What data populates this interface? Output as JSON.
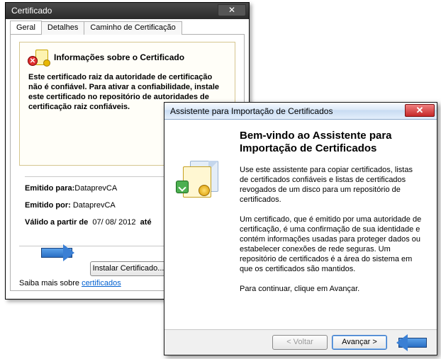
{
  "cert": {
    "window_title": "Certificado",
    "close_glyph": "✕",
    "tabs": {
      "general": "Geral",
      "details": "Detalhes",
      "path": "Caminho de Certificação"
    },
    "info_title": "Informações sobre o Certificado",
    "info_text": "Este certificado raiz da autoridade de certificação não é confiável. Para ativar a confiabilidade, instale este certificado no repositório de autoridades de certificação raiz confiáveis.",
    "issued_to_label": "Emitido para:",
    "issued_to_value": "DataprevCA",
    "issued_by_label": "Emitido por:",
    "issued_by_value": "DataprevCA",
    "valid_from_label": "Válido a partir de",
    "valid_from_value": "07/ 08/ 2012",
    "valid_until_word": "até",
    "install_btn": "Instalar Certificado...",
    "learn_more": "Saiba mais sobre",
    "learn_link": "certificados"
  },
  "wizard": {
    "window_title": "Assistente para Importação de Certificados",
    "close_glyph": "✕",
    "heading": "Bem-vindo ao Assistente para Importação de Certificados",
    "p1": "Use este assistente para copiar certificados, listas de certificados confiáveis e listas de certificados revogados de um disco para um repositório de certificados.",
    "p2": "Um certificado, que é emitido por uma autoridade de certificação, é uma confirmação de sua identidade e contém informações usadas para proteger dados ou estabelecer conexões de rede seguras. Um repositório de certificados é a área do sistema em que os certificados são mantidos.",
    "p3": "Para continuar, clique em Avançar.",
    "back_btn": "< Voltar",
    "next_btn": "Avançar >"
  }
}
